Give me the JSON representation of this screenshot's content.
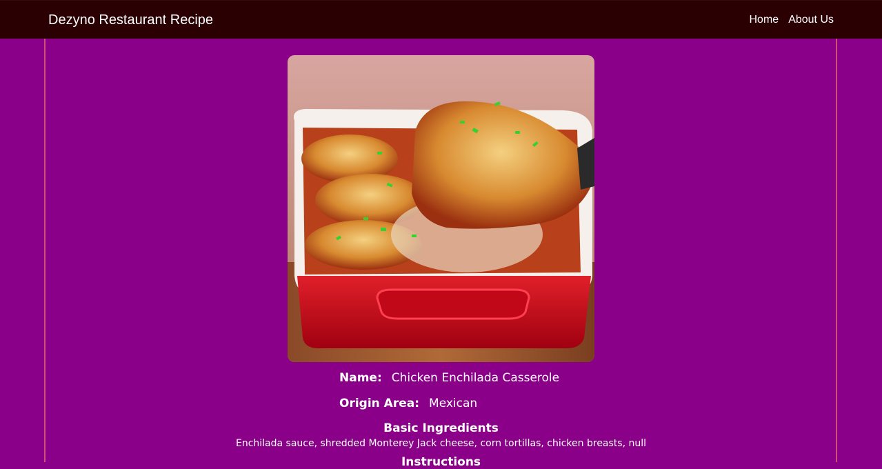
{
  "navbar": {
    "brand": "Dezyno Restaurant Recipe",
    "links": [
      "Home",
      "About Us"
    ]
  },
  "recipe": {
    "image_alt": "Chicken Enchilada Casserole",
    "name_label": "Name:",
    "name_value": "Chicken Enchilada Casserole",
    "area_label": "Origin Area:",
    "area_value": "Mexican",
    "ingredients_title": "Basic Ingredients",
    "ingredients_text": "Enchilada sauce, shredded Monterey Jack cheese, corn tortillas, chicken breasts, null",
    "instructions_title": "Instructions"
  },
  "colors": {
    "page_background": "#8a0088",
    "navbar_background": "#2b0003",
    "container_border": "#d0507a"
  }
}
